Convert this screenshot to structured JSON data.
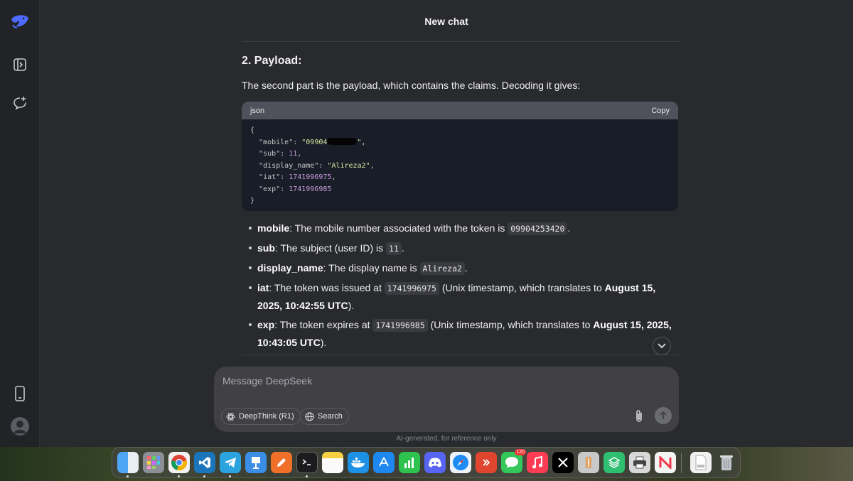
{
  "header": {
    "title": "New chat"
  },
  "message": {
    "section_heading": "2. Payload:",
    "intro": "The second part is the payload, which contains the claims. Decoding it gives:",
    "code_block": {
      "language": "json",
      "copy_label": "Copy",
      "lines": [
        {
          "key": "\"mobile\"",
          "value": "\"09904",
          "suffix": "\","
        },
        {
          "key": "\"sub\"",
          "value": "11",
          "suffix": ","
        },
        {
          "key": "\"display_name\"",
          "value": "\"Alireza2\"",
          "suffix": ","
        },
        {
          "key": "\"iat\"",
          "value": "1741996975",
          "suffix": ","
        },
        {
          "key": "\"exp\"",
          "value": "1741996985",
          "suffix": ""
        }
      ],
      "open_brace": "{",
      "close_brace": "}"
    },
    "bullets": [
      {
        "term": "mobile",
        "text1": ": The mobile number associated with the token is ",
        "code": "09904253420",
        "text2": "."
      },
      {
        "term": "sub",
        "text1": ": The subject (user ID) is ",
        "code": "11",
        "text2": "."
      },
      {
        "term": "display_name",
        "text1": ": The display name is ",
        "code": "Alireza2",
        "text2": "."
      },
      {
        "term": "iat",
        "text1": ": The token was issued at ",
        "code": "1741996975",
        "text2": " (Unix timestamp, which translates to ",
        "bold2": "August 15, 2025, 10:42:55 UTC",
        "text3": ")."
      },
      {
        "term": "exp",
        "text1": ": The token expires at ",
        "code": "1741996985",
        "text2": " (Unix timestamp, which translates to ",
        "bold2": "August 15, 2025, 10:43:05 UTC",
        "text3": ")."
      }
    ]
  },
  "composer": {
    "placeholder": "Message DeepSeek",
    "deepthink_label": "DeepThink (R1)",
    "search_label": "Search"
  },
  "disclaimer": "AI-generated, for reference only",
  "dock": {
    "messages_badge": "120",
    "apps": [
      "finder-icon",
      "launchpad-icon",
      "chrome-icon",
      "vscode-icon",
      "telegram-icon",
      "keynote-icon",
      "pencil-app-icon",
      "terminal-icon",
      "notes-icon",
      "docker-icon",
      "app-store-icon",
      "numbers-icon",
      "discord-icon",
      "safari-icon",
      "remote-desktop-icon",
      "messages-icon",
      "music-icon",
      "x-icon",
      "scripts-icon",
      "stack-icon",
      "printer-icon",
      "news-icon",
      "pdf-file-icon",
      "trash-icon"
    ]
  },
  "colors": {
    "background": "#292a2d",
    "sidebar": "#212327",
    "accent": "#4d6bfe",
    "code_bg": "#181d28"
  }
}
